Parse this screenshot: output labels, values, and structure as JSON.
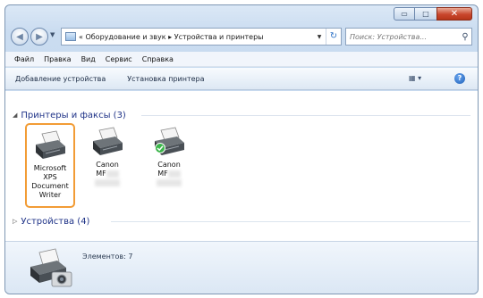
{
  "window": {
    "caption": {
      "minimize": "▭",
      "maximize": "□",
      "close": "✕"
    }
  },
  "nav": {
    "back": "◀",
    "forward": "▶",
    "address_path": "« Оборудование и звук ▸ Устройства и принтеры",
    "search_placeholder": "Поиск: Устройства...",
    "refresh": "↻"
  },
  "menu": [
    "Файл",
    "Правка",
    "Вид",
    "Сервис",
    "Справка"
  ],
  "commands": {
    "add_device": "Добавление устройства",
    "add_printer": "Установка принтера",
    "help": "?"
  },
  "groups": {
    "printers": {
      "label": "Принтеры и факсы (3)",
      "arrow": "◢"
    },
    "devices": {
      "label": "Устройства (4)",
      "arrow": "▷"
    }
  },
  "printers": [
    {
      "name": "Microsoft XPS Document Writer",
      "selected": true,
      "default": false
    },
    {
      "name": "Canon",
      "model": "MF",
      "selected": false,
      "default": false
    },
    {
      "name": "Canon",
      "model": "MF",
      "selected": false,
      "default": true
    }
  ],
  "details": {
    "count": "Элементов: 7"
  },
  "colors": {
    "selection_border": "#f29c35",
    "group_header": "#1e3287",
    "close_button": "#c9472d",
    "default_check": "#3bb54a"
  }
}
